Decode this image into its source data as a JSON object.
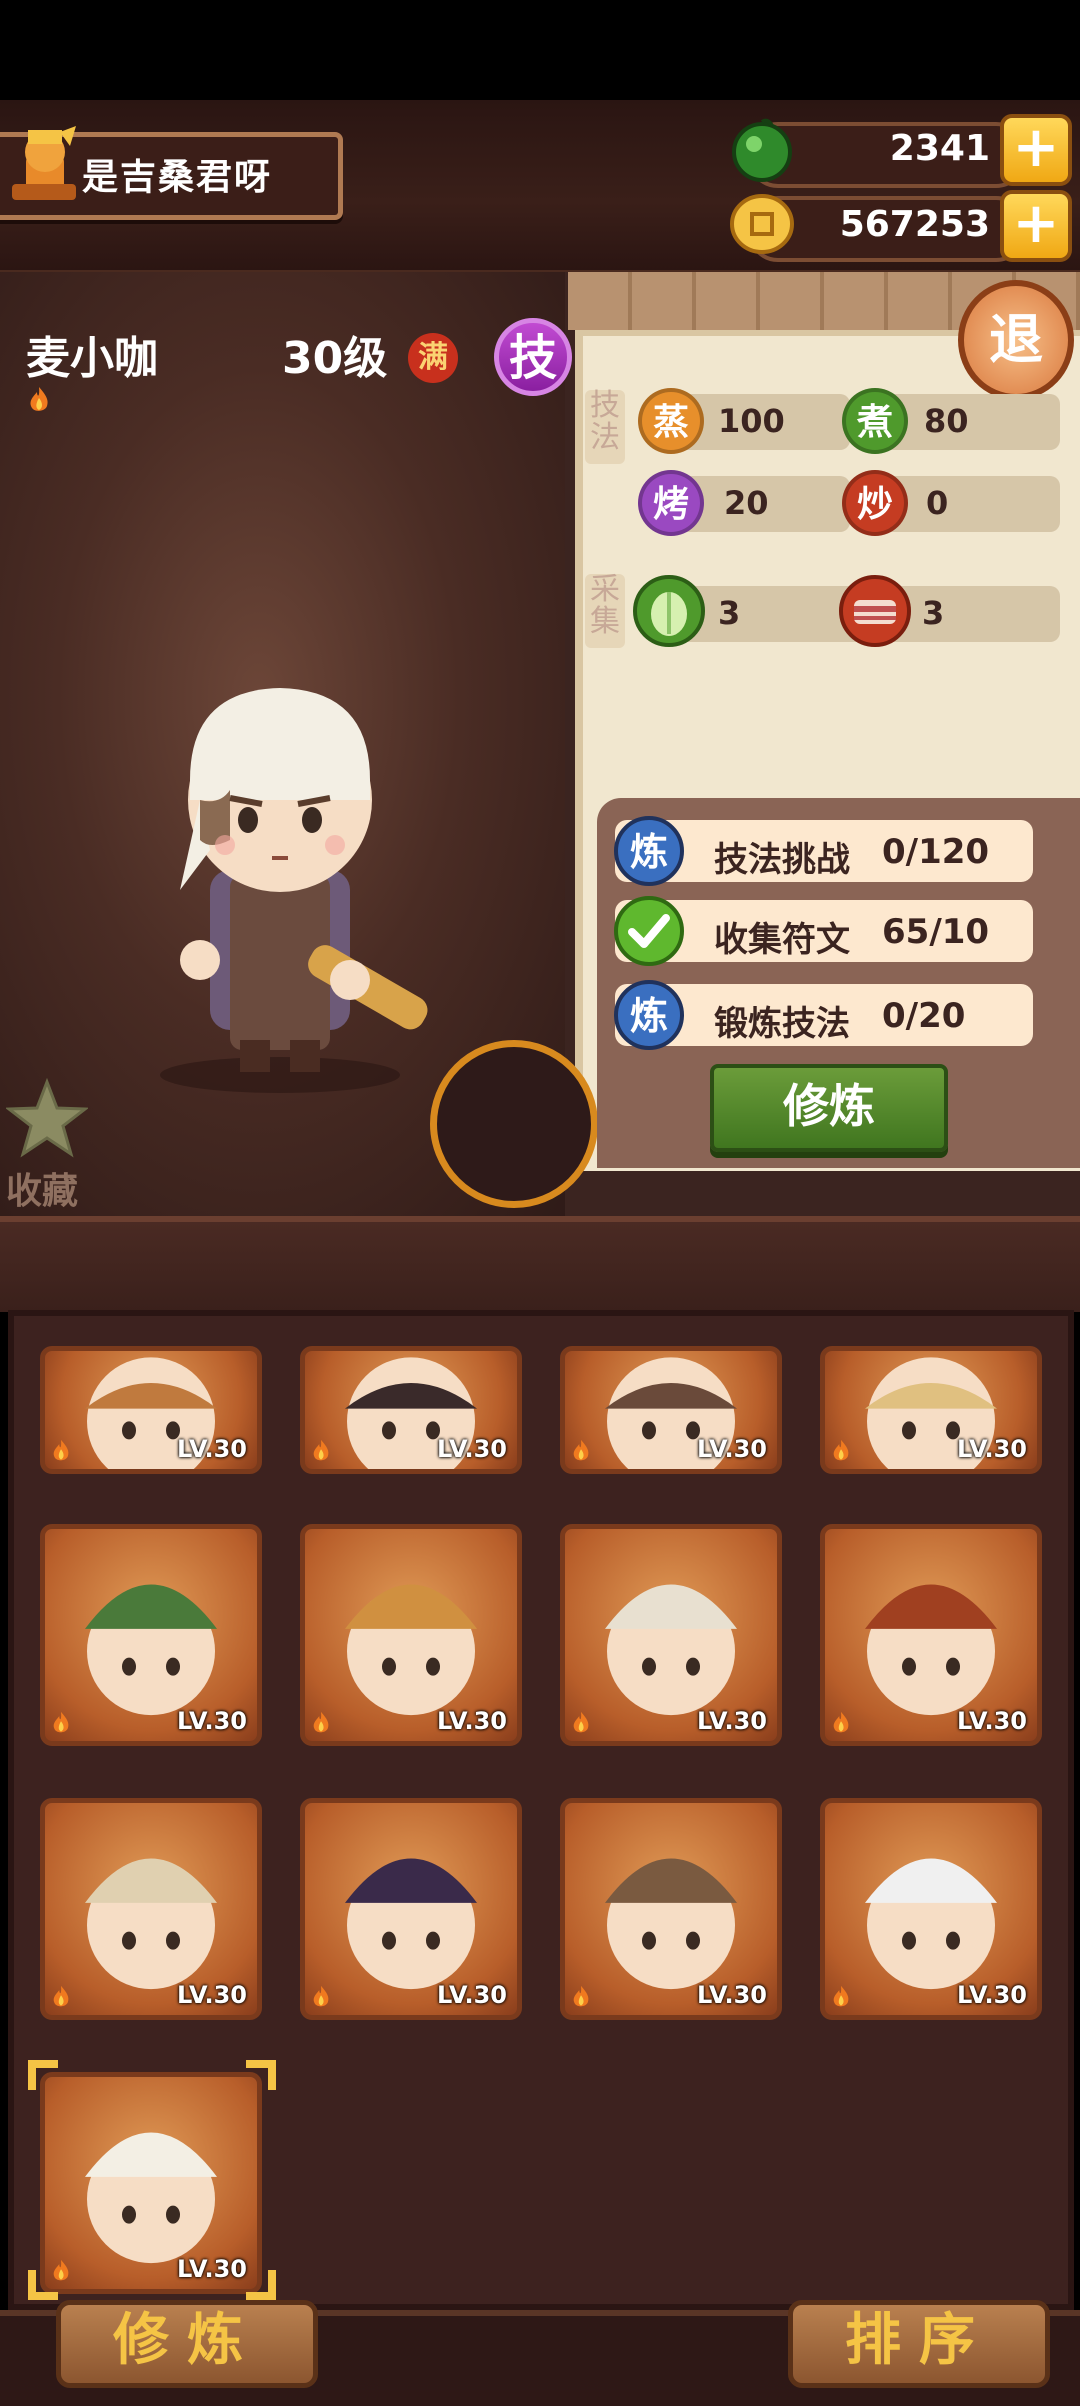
{
  "player": {
    "name": "是吉桑君呀"
  },
  "currency": {
    "jade": "2341",
    "coins": "567253"
  },
  "character": {
    "name": "麦小咖",
    "level": "30级",
    "full_badge": "满",
    "skill_badge": "技"
  },
  "exit_label": "退",
  "skills": {
    "section_label": "技法",
    "items": [
      {
        "icon_text": "蒸",
        "value": "100",
        "color": "#e78f2b"
      },
      {
        "icon_text": "煮",
        "value": "80",
        "color": "#4f9a2c"
      },
      {
        "icon_text": "烤",
        "value": "20",
        "color": "#9a49c1"
      },
      {
        "icon_text": "炒",
        "value": "0",
        "color": "#c53c22"
      }
    ]
  },
  "gather": {
    "section_label": "采集",
    "items": [
      {
        "icon_name": "cabbage-icon",
        "value": "3"
      },
      {
        "icon_name": "meat-icon",
        "value": "3"
      }
    ]
  },
  "tasks": [
    {
      "icon_text": "炼",
      "label": "技法挑战",
      "progress": "0/120",
      "done": false
    },
    {
      "icon_text": "",
      "label": "收集符文",
      "progress": "65/10",
      "done": true
    },
    {
      "icon_text": "炼",
      "label": "锻炼技法",
      "progress": "0/20",
      "done": false
    }
  ],
  "refine_button": "修炼",
  "favorite_label": "收藏",
  "roster": {
    "level_label": "LV.30"
  },
  "bottom": {
    "refine": "修炼",
    "sort": "排序"
  },
  "colors": {
    "accent_gold": "#f5c445",
    "panel_cream": "#f1e7cf",
    "wood_dark": "#3b1e18"
  }
}
